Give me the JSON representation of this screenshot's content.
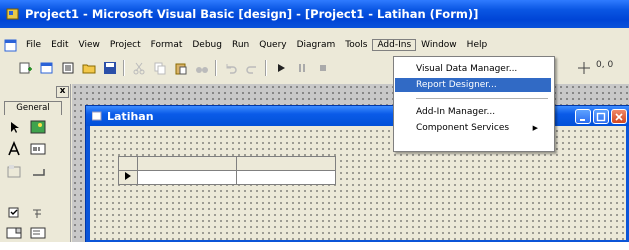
{
  "window": {
    "title": "Project1 - Microsoft Visual Basic [design] - [Project1 - Latihan (Form)]"
  },
  "menubar": {
    "items": [
      "File",
      "Edit",
      "View",
      "Project",
      "Format",
      "Debug",
      "Run",
      "Query",
      "Diagram",
      "Tools",
      "Add-Ins",
      "Window",
      "Help"
    ],
    "active": "Add-Ins"
  },
  "toolbar": {
    "position_readout": "0, 0"
  },
  "addins_menu": {
    "items": [
      {
        "label": "Visual Data Manager...",
        "highlighted": false
      },
      {
        "label": "Report Designer...",
        "highlighted": true
      },
      {
        "label": "Add-In Manager...",
        "highlighted": false
      },
      {
        "label": "Component Services",
        "highlighted": false,
        "submenu": true
      }
    ],
    "highlight_color": "#316ac5"
  },
  "toolbox": {
    "tab_label": "General",
    "close_label": "x",
    "tools": [
      "pointer-icon",
      "picturebox-icon",
      "label-icon",
      "textbox-icon",
      "frame-icon",
      "commandbutton-icon",
      "checkbox-icon",
      "optionbutton-icon",
      "combobox-icon",
      "listbox-icon"
    ]
  },
  "form": {
    "caption": "Latihan"
  },
  "colors": {
    "titlebar": "#0a56e3",
    "form_titlebar": "#0a5be8",
    "face": "#ece9d8"
  }
}
